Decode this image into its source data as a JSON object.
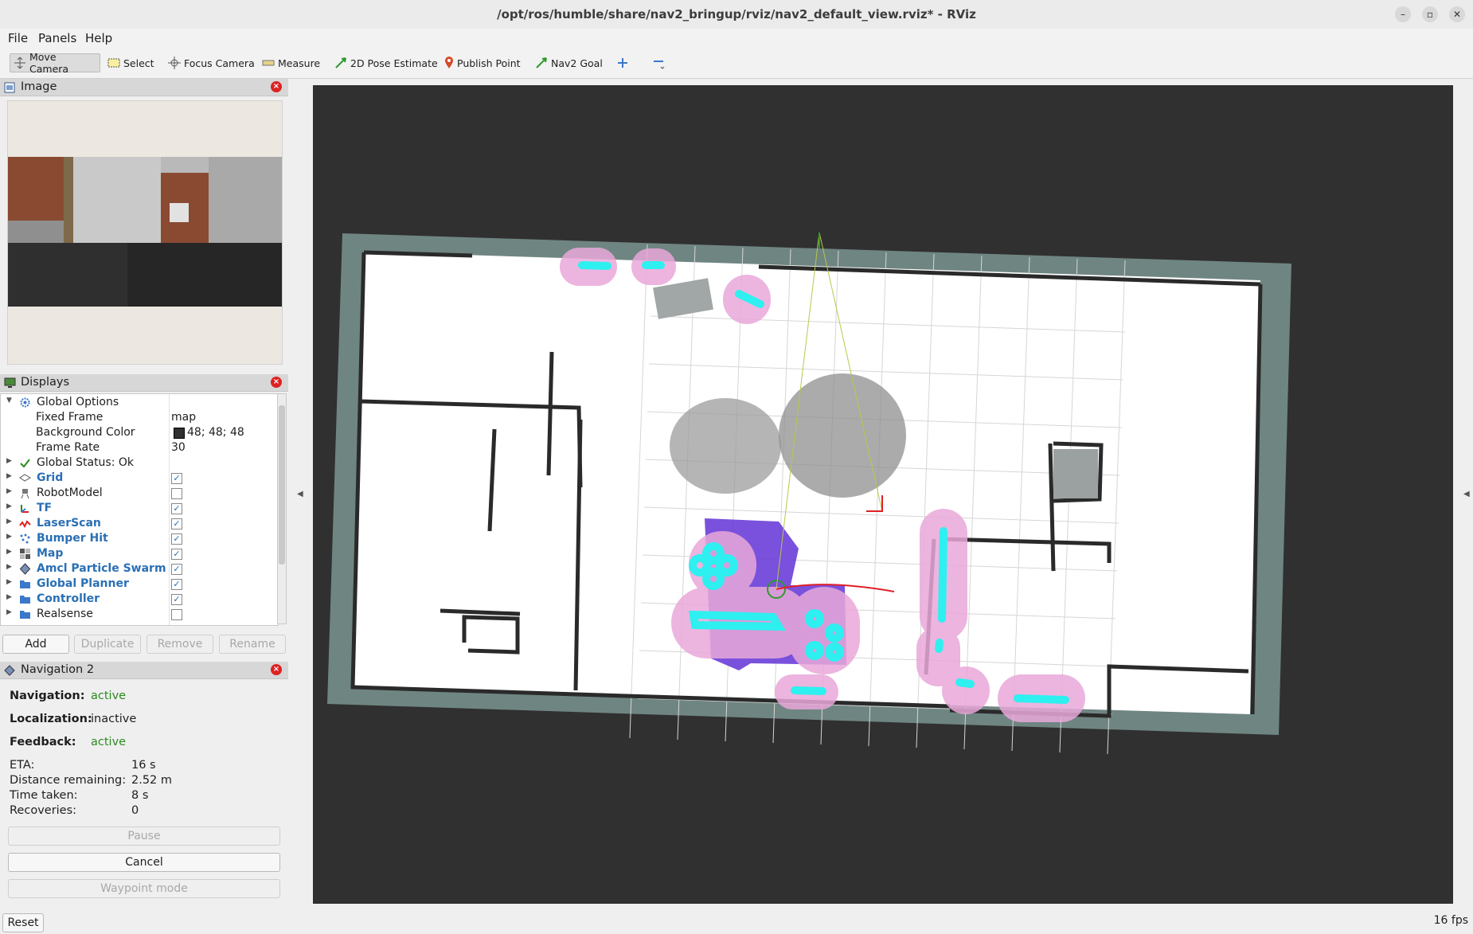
{
  "window": {
    "title": "/opt/ros/humble/share/nav2_bringup/rviz/nav2_default_view.rviz* - RViz",
    "minimize_label": "–",
    "maximize_label": "▫",
    "close_label": "✕"
  },
  "menu": [
    "File",
    "Panels",
    "Help"
  ],
  "toolbar": {
    "move_camera": "Move Camera",
    "select": "Select",
    "focus_camera": "Focus Camera",
    "measure": "Measure",
    "pose_estimate": "2D Pose Estimate",
    "publish_point": "Publish Point",
    "nav2_goal": "Nav2 Goal"
  },
  "image_panel": {
    "title": "Image"
  },
  "displays_panel": {
    "title": "Displays",
    "rows": [
      {
        "label": "Global Options",
        "icon": "gear-icon"
      },
      {
        "label": "Fixed Frame",
        "value": "map"
      },
      {
        "label": "Background Color",
        "value": "48; 48; 48"
      },
      {
        "label": "Frame Rate",
        "value": "30"
      },
      {
        "label": "Global Status: Ok",
        "icon": "check-icon"
      },
      {
        "label": "Grid",
        "checked": true
      },
      {
        "label": "RobotModel",
        "checked": false
      },
      {
        "label": "TF",
        "checked": true
      },
      {
        "label": "LaserScan",
        "checked": true
      },
      {
        "label": "Bumper Hit",
        "checked": true
      },
      {
        "label": "Map",
        "checked": true
      },
      {
        "label": "Amcl Particle Swarm",
        "checked": true
      },
      {
        "label": "Global Planner",
        "checked": true
      },
      {
        "label": "Controller",
        "checked": true
      },
      {
        "label": "Realsense",
        "checked": false
      }
    ],
    "buttons": {
      "add": "Add",
      "duplicate": "Duplicate",
      "remove": "Remove",
      "rename": "Rename"
    }
  },
  "navigation_panel": {
    "title": "Navigation 2",
    "navigation_label": "Navigation:",
    "navigation_value": "active",
    "localization_label": "Localization:",
    "localization_value": "inactive",
    "feedback_label": "Feedback:",
    "feedback_value": "active",
    "eta_label": "ETA:",
    "eta_value": "16 s",
    "distance_label": "Distance remaining:",
    "distance_value": "2.52 m",
    "time_label": "Time taken:",
    "time_value": "8 s",
    "recoveries_label": "Recoveries:",
    "recoveries_value": "0",
    "pause": "Pause",
    "cancel": "Cancel",
    "waypoint": "Waypoint mode"
  },
  "status": {
    "reset": "Reset",
    "fps": "16 fps"
  },
  "colors": {
    "background": "#303030",
    "map_border": "#6f8582",
    "costmap_cyan": "#2ef0f0",
    "costmap_pink": "#e8a6d8",
    "accent_blue": "#2a6fb5"
  }
}
